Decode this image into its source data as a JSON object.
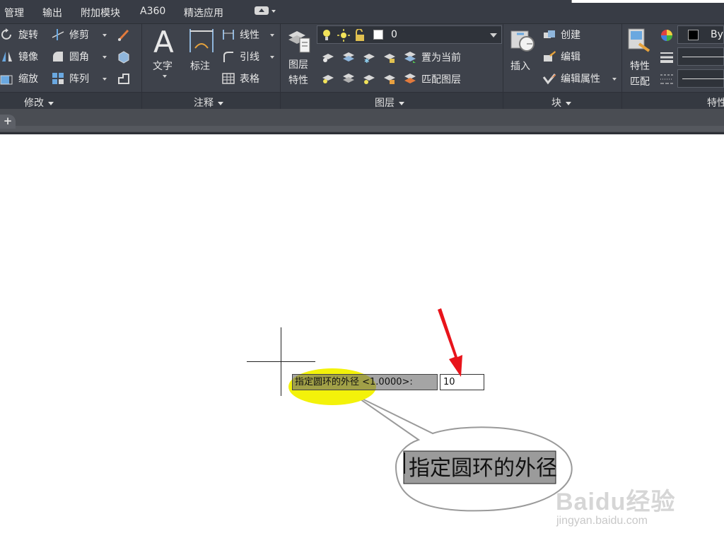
{
  "menubar": {
    "items": [
      "管理",
      "输出",
      "附加模块",
      "A360",
      "精选应用"
    ]
  },
  "ribbon": {
    "modify": {
      "title": "修改",
      "tools": [
        "旋转",
        "修剪",
        "镜像",
        "圆角",
        "缩放",
        "阵列"
      ]
    },
    "annotation": {
      "title": "注释",
      "text_label": "文字",
      "dim_label": "标注",
      "tools": [
        "线性",
        "引线",
        "表格"
      ]
    },
    "layers": {
      "title": "图层",
      "props_label_1": "图层",
      "props_label_2": "特性",
      "current_layer": "0",
      "tools": [
        "置为当前",
        "匹配图层"
      ]
    },
    "block": {
      "title": "块",
      "insert_label": "插入",
      "tools": [
        "创建",
        "编辑",
        "编辑属性"
      ]
    },
    "properties": {
      "title": "特性",
      "match_label_1": "特性",
      "match_label_2": "匹配",
      "color_value": "ByL"
    }
  },
  "canvas": {
    "prompt_text": "指定圆环的外径 <1.0000>:",
    "input_value": "10",
    "callout_text": "指定圆环的外径"
  },
  "watermark": {
    "logo": "Baidu经验",
    "url": "jingyan.baidu.com"
  },
  "colors": {
    "menubar_bg": "#383c45",
    "ribbon_bg": "#3e424b",
    "highlight": "#f3f20a",
    "arrow": "#e8141b"
  }
}
